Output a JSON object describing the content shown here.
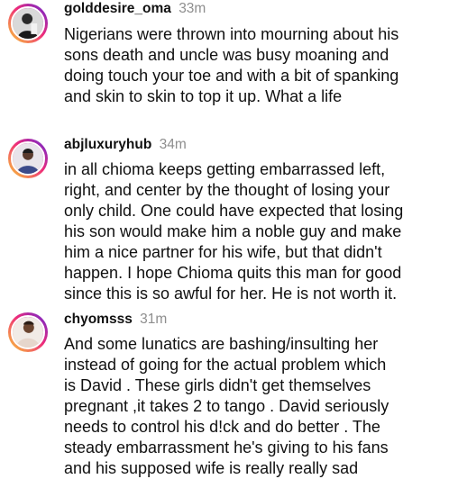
{
  "comments": [
    {
      "username": "golddesire_oma",
      "time": "33m",
      "avatar_icon": "user-avatar-black-white-photo",
      "text": "Nigerians were thrown into mourning about his\nsons death and uncle was busy moaning and\ndoing touch your toe and with a bit of spanking\nand skin to skin to top it up. What a life"
    },
    {
      "username": "abjluxuryhub",
      "time": "34m",
      "avatar_icon": "user-avatar-person-photo",
      "text": "in all chioma keeps getting embarrassed left,\nright, and center by the thought of losing your\nonly child. One could have expected that losing\nhis son would make him a noble guy and make\nhim a nice partner for his wife, but that didn't\nhappen. I hope Chioma quits this man for good\nsince this is so awful for her. He is not worth it."
    },
    {
      "username": "chyomsss",
      "time": "31m",
      "avatar_icon": "user-avatar-person-photo",
      "text": "And some lunatics are bashing/insulting her\ninstead of going for the actual problem which\nis David . These girls didn't get themselves\npregnant ,it takes 2 to tango . David seriously\nneeds to control his d!ck and do better . The\nsteady embarrassment he's giving to his fans\nand his supposed wife is really really sad"
    }
  ],
  "colors": {
    "text": "#111111",
    "timestamp": "#8e8e8e",
    "story_ring_start": "#f9ce34",
    "story_ring_mid": "#ee2a7b",
    "story_ring_end": "#6228d7"
  }
}
